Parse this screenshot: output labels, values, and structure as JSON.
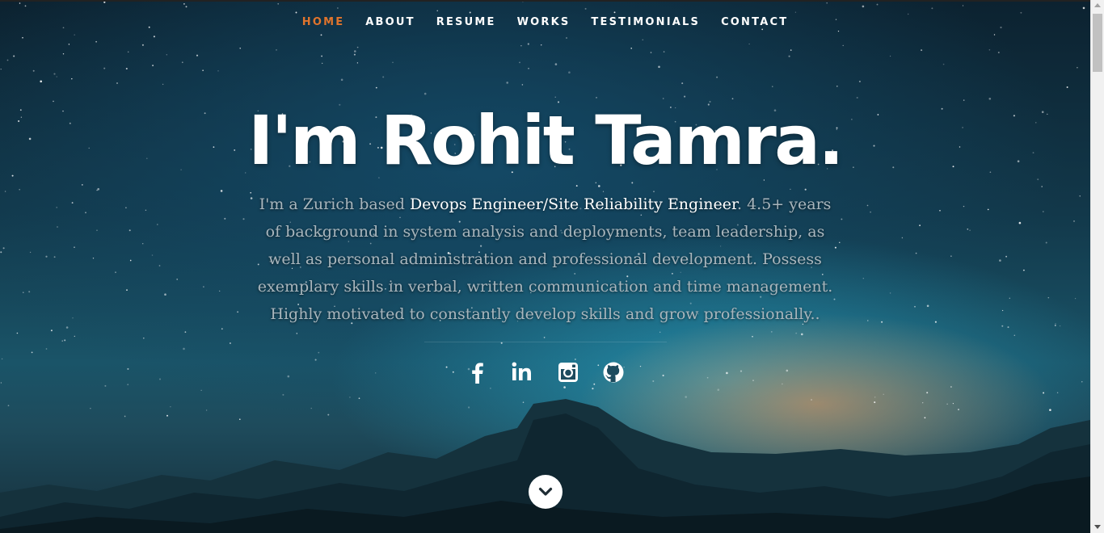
{
  "nav": {
    "items": [
      {
        "label": "HOME",
        "active": true
      },
      {
        "label": "ABOUT",
        "active": false
      },
      {
        "label": "RESUME",
        "active": false
      },
      {
        "label": "WORKS",
        "active": false
      },
      {
        "label": "TESTIMONIALS",
        "active": false
      },
      {
        "label": "CONTACT",
        "active": false
      }
    ],
    "active_color": "#e0742c"
  },
  "banner": {
    "headline": "I'm Rohit Tamra.",
    "intro_prefix": "I'm a Zurich based ",
    "intro_highlight": "Devops Engineer/Site Reliability Engineer",
    "intro_suffix": ". 4.5+ years of background in system analysis and deployments, team leadership, as well as personal administration and professional development. Possess exemplary skills in verbal, written communication and time management. Highly motivated to constantly develop skills and grow professionally.."
  },
  "social": [
    {
      "icon": "facebook-icon"
    },
    {
      "icon": "linkedin-icon"
    },
    {
      "icon": "instagram-icon"
    },
    {
      "icon": "github-icon"
    }
  ],
  "scrolldown": {
    "icon": "chevron-down-icon"
  }
}
